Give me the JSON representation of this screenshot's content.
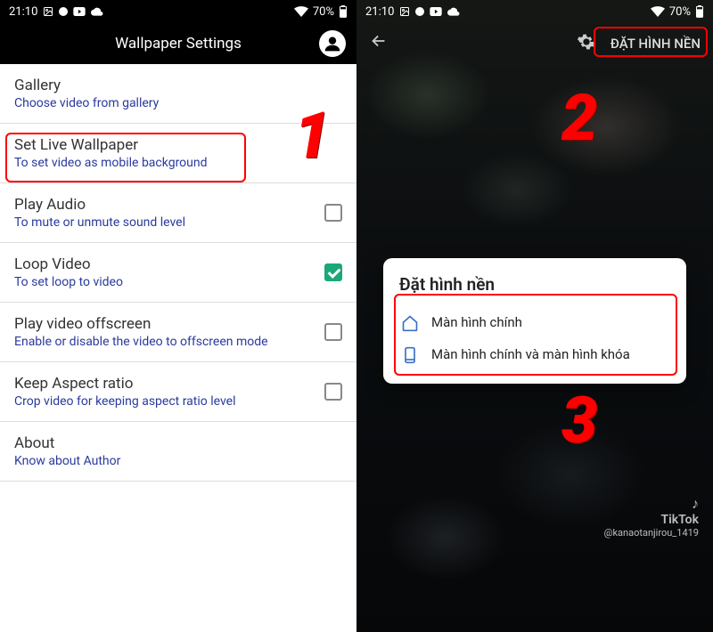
{
  "status": {
    "time": "21:10",
    "battery": "70%"
  },
  "left": {
    "title": "Wallpaper Settings",
    "items": [
      {
        "title": "Gallery",
        "sub": "Choose video from gallery",
        "has_checkbox": false
      },
      {
        "title": "Set Live Wallpaper",
        "sub": "To set video as mobile background",
        "has_checkbox": false
      },
      {
        "title": "Play Audio",
        "sub": "To mute or unmute sound level",
        "has_checkbox": true,
        "checked": false
      },
      {
        "title": "Loop Video",
        "sub": "To set loop to video",
        "has_checkbox": true,
        "checked": true
      },
      {
        "title": "Play video offscreen",
        "sub": "Enable or disable the video to offscreen mode",
        "has_checkbox": true,
        "checked": false
      },
      {
        "title": "Keep Aspect ratio",
        "sub": "Crop video for keeping aspect ratio level",
        "has_checkbox": true,
        "checked": false
      },
      {
        "title": "About",
        "sub": "Know about Author",
        "has_checkbox": false
      }
    ]
  },
  "right": {
    "set_btn": "ĐẶT HÌNH NỀN",
    "dialog_title": "Đặt hình nền",
    "option1": "Màn hình chính",
    "option2": "Màn hình chính và màn hình khóa",
    "tiktok_name": "TikTok",
    "tiktok_user": "@kanaotanjirou_1419"
  },
  "annotations": {
    "num1": "1",
    "num2": "2",
    "num3": "3"
  }
}
